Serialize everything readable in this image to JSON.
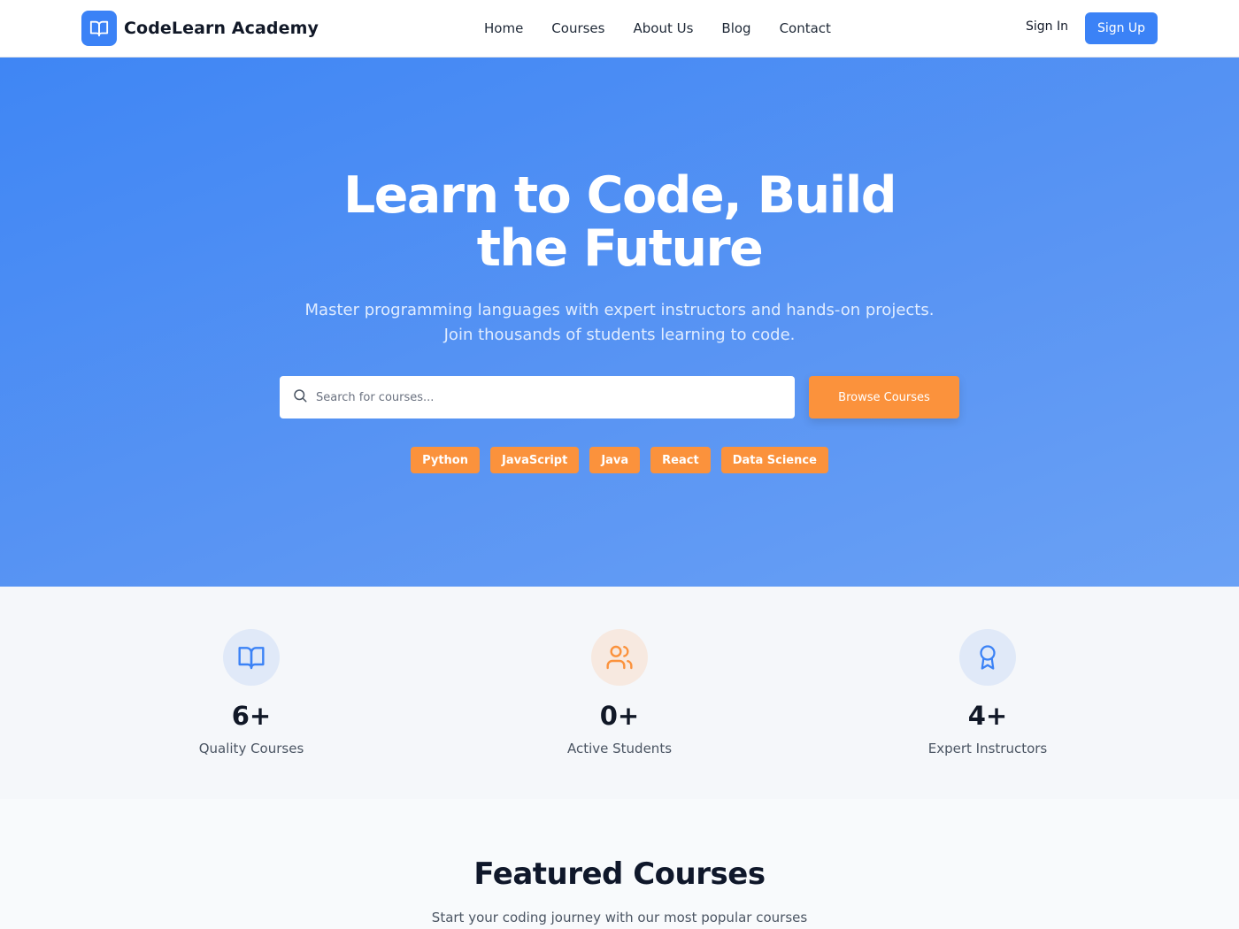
{
  "brand": {
    "name": "CodeLearn Academy",
    "icon": "book-open-icon",
    "accent": "#3b82f6",
    "orange": "#fb923c"
  },
  "nav": {
    "items": [
      "Home",
      "Courses",
      "About Us",
      "Blog",
      "Contact"
    ],
    "sign_in": "Sign In",
    "sign_up": "Sign Up"
  },
  "hero": {
    "title": "Learn to Code, Build the Future",
    "subtitle_line1": "Master programming languages with expert instructors and hands-on projects.",
    "subtitle_line2": "Join thousands of students learning to code.",
    "search_placeholder": "Search for courses...",
    "search_icon": "search-icon",
    "browse_label": "Browse Courses",
    "tags": [
      "Python",
      "JavaScript",
      "Java",
      "React",
      "Data Science"
    ]
  },
  "stats": [
    {
      "icon": "book-open-icon",
      "value": "6+",
      "label": "Quality Courses"
    },
    {
      "icon": "users-icon",
      "value": "0+",
      "label": "Active Students"
    },
    {
      "icon": "award-icon",
      "value": "4+",
      "label": "Expert Instructors"
    }
  ],
  "featured": {
    "title": "Featured Courses",
    "subtitle": "Start your coding journey with our most popular courses"
  }
}
